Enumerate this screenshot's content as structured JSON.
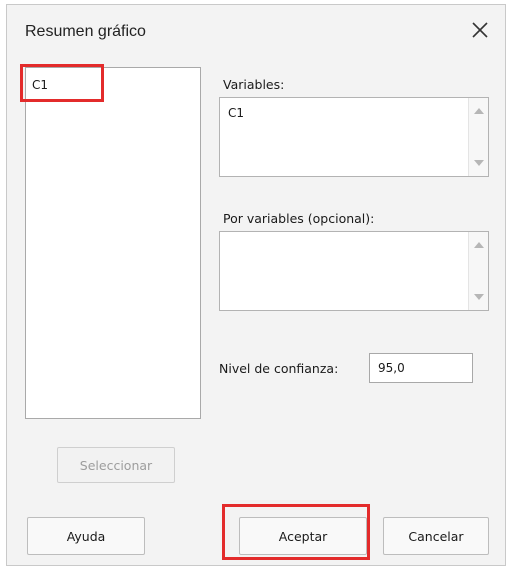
{
  "dialog": {
    "title": "Resumen gráfico",
    "close_icon": "close-icon"
  },
  "column_list": {
    "items": [
      "C1"
    ],
    "select_button": "Seleccionar"
  },
  "variables": {
    "label": "Variables:",
    "value": "C1"
  },
  "by_variables": {
    "label": "Por variables (opcional):",
    "value": ""
  },
  "confidence": {
    "label": "Nivel de confianza:",
    "value": "95,0"
  },
  "buttons": {
    "help": "Ayuda",
    "accept": "Aceptar",
    "cancel": "Cancelar"
  },
  "highlight_color": "#e32b2b"
}
